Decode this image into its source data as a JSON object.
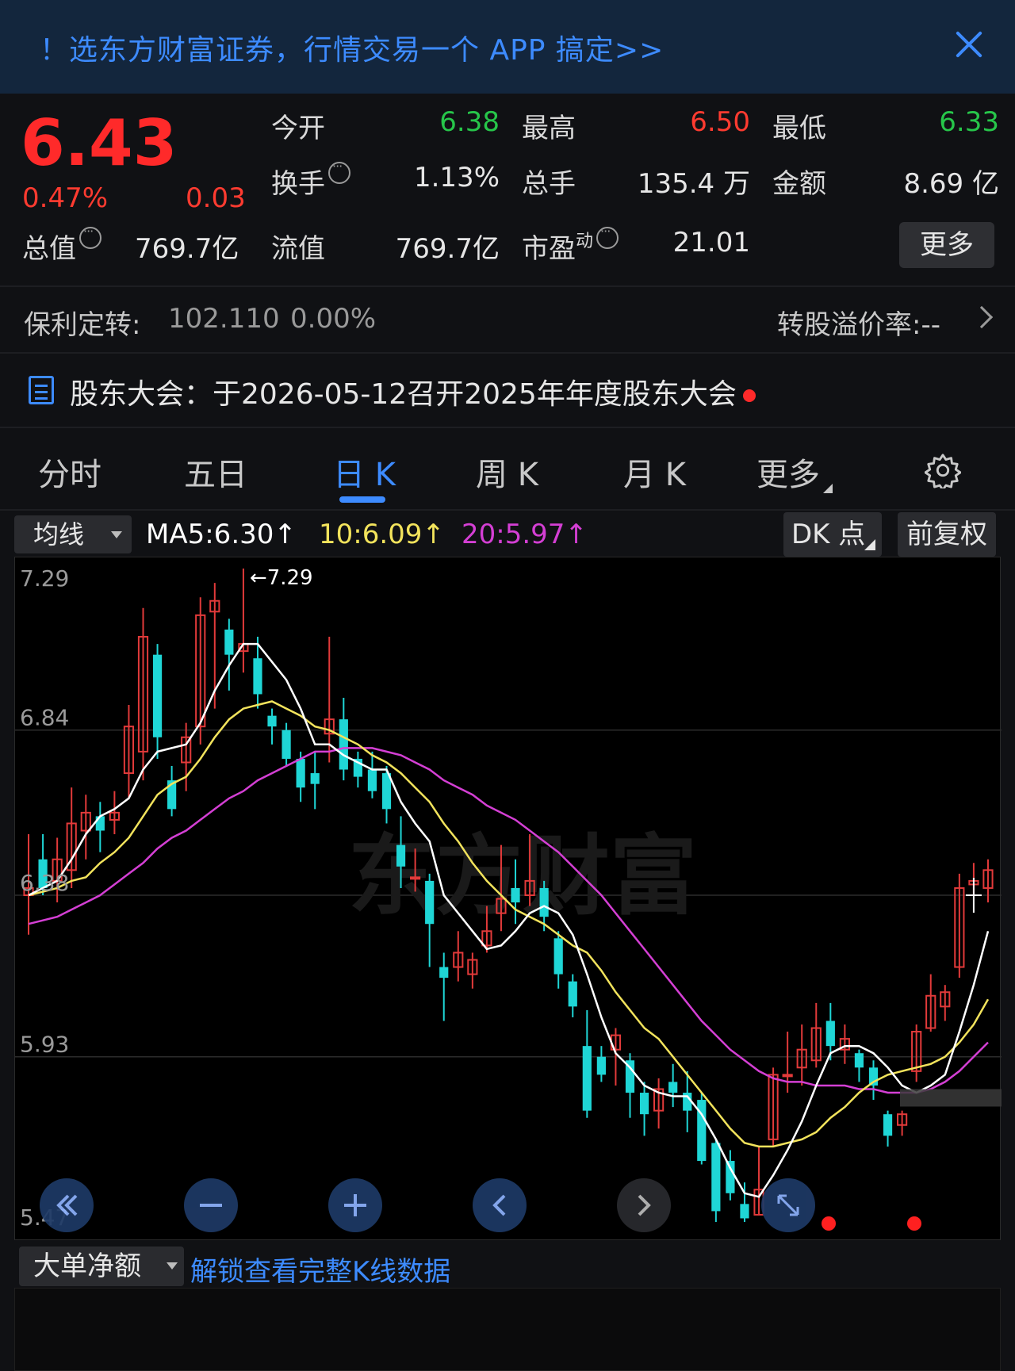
{
  "banner": {
    "text": "！选东方财富证券，行情交易一个 APP 搞定>>"
  },
  "quote": {
    "price": "6.43",
    "change_pct": "0.47%",
    "change_abs": "0.03",
    "total_value_label": "总值",
    "total_value": "769.7亿",
    "open_label": "今开",
    "open": "6.38",
    "high_label": "最高",
    "high": "6.50",
    "low_label": "最低",
    "low": "6.33",
    "turnover_label": "换手",
    "turnover": "1.13%",
    "volume_label": "总手",
    "volume": "135.4 万",
    "amount_label": "金额",
    "amount": "8.69 亿",
    "float_label": "流值",
    "float": "769.7亿",
    "pe_label": "市盈",
    "pe_sup": "动",
    "pe": "21.01",
    "more_label": "更多"
  },
  "convertible": {
    "label": "保利定转:",
    "price": "102.110",
    "pct": "0.00%",
    "premium": "转股溢价率:--"
  },
  "notice": {
    "text": "股东大会：于2026-05-12召开2025年年度股东大会"
  },
  "tabs": [
    {
      "label": "分时"
    },
    {
      "label": "五日"
    },
    {
      "label": "日 K"
    },
    {
      "label": "周 K"
    },
    {
      "label": "月 K"
    },
    {
      "label": "更多"
    }
  ],
  "ma": {
    "selector": "均线",
    "ma5": "MA5:6.30↑",
    "ma10": "10:6.09↑",
    "ma20": "20:5.97↑",
    "dk": "DK 点",
    "fq": "前复权"
  },
  "chart_data": {
    "type": "candlestick",
    "y_ticks": [
      "7.29",
      "6.84",
      "6.38",
      "5.93",
      "5.47"
    ],
    "ylim": [
      5.47,
      7.29
    ],
    "max_label": "←7.29",
    "watermark": "东方财富",
    "candles": [
      [
        6.38,
        6.4,
        6.55,
        6.27
      ],
      [
        6.48,
        6.4,
        6.55,
        6.38
      ],
      [
        6.42,
        6.48,
        6.54,
        6.36
      ],
      [
        6.45,
        6.58,
        6.68,
        6.4
      ],
      [
        6.56,
        6.61,
        6.66,
        6.48
      ],
      [
        6.6,
        6.56,
        6.64,
        6.5
      ],
      [
        6.59,
        6.61,
        6.67,
        6.55
      ],
      [
        6.72,
        6.85,
        6.91,
        6.65
      ],
      [
        6.78,
        7.1,
        7.18,
        6.7
      ],
      [
        7.05,
        6.82,
        7.08,
        6.76
      ],
      [
        6.7,
        6.62,
        6.74,
        6.6
      ],
      [
        6.75,
        6.82,
        6.86,
        6.67
      ],
      [
        6.85,
        7.16,
        7.21,
        6.8
      ],
      [
        7.17,
        7.2,
        7.25,
        6.9
      ],
      [
        7.12,
        7.05,
        7.15,
        6.95
      ],
      [
        7.06,
        7.08,
        7.29,
        7.0
      ],
      [
        7.04,
        6.94,
        7.1,
        6.9
      ],
      [
        6.88,
        6.85,
        6.9,
        6.8
      ],
      [
        6.84,
        6.76,
        6.86,
        6.74
      ],
      [
        6.76,
        6.68,
        6.78,
        6.64
      ],
      [
        6.72,
        6.69,
        6.78,
        6.62
      ],
      [
        6.83,
        6.87,
        7.1,
        6.75
      ],
      [
        6.87,
        6.73,
        6.93,
        6.7
      ],
      [
        6.76,
        6.71,
        6.78,
        6.68
      ],
      [
        6.73,
        6.67,
        6.78,
        6.65
      ],
      [
        6.72,
        6.62,
        6.74,
        6.58
      ],
      [
        6.52,
        6.46,
        6.6,
        6.4
      ],
      [
        6.43,
        6.43,
        6.51,
        6.39
      ],
      [
        6.42,
        6.3,
        6.44,
        6.18
      ],
      [
        6.18,
        6.15,
        6.22,
        6.03
      ],
      [
        6.18,
        6.22,
        6.28,
        6.14
      ],
      [
        6.16,
        6.2,
        6.22,
        6.12
      ],
      [
        6.24,
        6.28,
        6.35,
        6.22
      ],
      [
        6.33,
        6.37,
        6.52,
        6.28
      ],
      [
        6.4,
        6.36,
        6.48,
        6.3
      ],
      [
        6.38,
        6.42,
        6.55,
        6.35
      ],
      [
        6.4,
        6.32,
        6.42,
        6.28
      ],
      [
        6.26,
        6.16,
        6.28,
        6.12
      ],
      [
        6.14,
        6.07,
        6.16,
        6.04
      ],
      [
        5.96,
        5.78,
        6.06,
        5.76
      ],
      [
        5.93,
        5.88,
        5.96,
        5.86
      ],
      [
        5.95,
        5.99,
        6.01,
        5.85
      ],
      [
        5.92,
        5.83,
        5.94,
        5.76
      ],
      [
        5.83,
        5.77,
        5.86,
        5.71
      ],
      [
        5.78,
        5.84,
        5.87,
        5.73
      ],
      [
        5.86,
        5.83,
        5.91,
        5.79
      ],
      [
        5.83,
        5.78,
        5.89,
        5.72
      ],
      [
        5.81,
        5.64,
        5.83,
        5.63
      ],
      [
        5.69,
        5.5,
        5.7,
        5.47
      ],
      [
        5.64,
        5.55,
        5.67,
        5.53
      ],
      [
        5.52,
        5.48,
        5.58,
        5.47
      ],
      [
        5.49,
        5.56,
        5.68,
        5.49
      ],
      [
        5.7,
        5.88,
        5.9,
        5.68
      ],
      [
        5.88,
        5.88,
        6.0,
        5.83
      ],
      [
        5.9,
        5.95,
        6.02,
        5.85
      ],
      [
        5.92,
        6.01,
        6.08,
        5.9
      ],
      [
        6.03,
        5.96,
        6.08,
        5.92
      ],
      [
        5.95,
        5.98,
        6.02,
        5.91
      ],
      [
        5.94,
        5.9,
        5.95,
        5.86
      ],
      [
        5.9,
        5.85,
        5.92,
        5.81
      ],
      [
        5.77,
        5.71,
        5.78,
        5.68
      ],
      [
        5.74,
        5.77,
        5.78,
        5.71
      ],
      [
        5.89,
        6.0,
        6.02,
        5.86
      ],
      [
        6.01,
        6.1,
        6.16,
        6.0
      ],
      [
        6.07,
        6.11,
        6.13,
        6.03
      ],
      [
        6.18,
        6.4,
        6.44,
        6.15
      ],
      [
        6.41,
        6.42,
        6.47,
        6.38
      ],
      [
        6.4,
        6.45,
        6.48,
        6.36
      ]
    ],
    "ma5": [
      6.38,
      6.4,
      6.42,
      6.48,
      6.55,
      6.6,
      6.62,
      6.65,
      6.73,
      6.78,
      6.79,
      6.8,
      6.86,
      6.95,
      7.02,
      7.08,
      7.08,
      7.03,
      6.98,
      6.9,
      6.8,
      6.8,
      6.77,
      6.75,
      6.73,
      6.73,
      6.64,
      6.58,
      6.53,
      6.38,
      6.33,
      6.28,
      6.23,
      6.24,
      6.28,
      6.33,
      6.35,
      6.33,
      6.27,
      6.16,
      6.04,
      5.94,
      5.9,
      5.85,
      5.83,
      5.82,
      5.82,
      5.77,
      5.7,
      5.62,
      5.55,
      5.54,
      5.6,
      5.67,
      5.75,
      5.85,
      5.94,
      5.96,
      5.96,
      5.94,
      5.9,
      5.85,
      5.83,
      5.85,
      5.88,
      6.0,
      6.13,
      6.28
    ],
    "ma10": [
      6.38,
      6.39,
      6.4,
      6.42,
      6.43,
      6.47,
      6.5,
      6.54,
      6.6,
      6.66,
      6.69,
      6.71,
      6.76,
      6.82,
      6.87,
      6.9,
      6.91,
      6.92,
      6.9,
      6.88,
      6.85,
      6.84,
      6.82,
      6.8,
      6.77,
      6.75,
      6.72,
      6.68,
      6.64,
      6.58,
      6.53,
      6.47,
      6.42,
      6.38,
      6.34,
      6.32,
      6.3,
      6.27,
      6.24,
      6.22,
      6.17,
      6.11,
      6.06,
      6.01,
      5.98,
      5.93,
      5.88,
      5.83,
      5.78,
      5.73,
      5.69,
      5.68,
      5.68,
      5.69,
      5.7,
      5.72,
      5.76,
      5.79,
      5.83,
      5.86,
      5.88,
      5.89,
      5.9,
      5.91,
      5.93,
      5.97,
      6.02,
      6.09
    ],
    "ma20": [
      6.3,
      6.31,
      6.32,
      6.34,
      6.36,
      6.38,
      6.41,
      6.44,
      6.47,
      6.51,
      6.54,
      6.56,
      6.59,
      6.62,
      6.65,
      6.67,
      6.7,
      6.72,
      6.74,
      6.76,
      6.78,
      6.78,
      6.79,
      6.79,
      6.79,
      6.78,
      6.77,
      6.75,
      6.73,
      6.7,
      6.68,
      6.66,
      6.63,
      6.61,
      6.59,
      6.56,
      6.53,
      6.5,
      6.46,
      6.42,
      6.38,
      6.33,
      6.28,
      6.23,
      6.18,
      6.13,
      6.08,
      6.03,
      5.99,
      5.95,
      5.92,
      5.89,
      5.87,
      5.86,
      5.86,
      5.85,
      5.85,
      5.85,
      5.84,
      5.84,
      5.83,
      5.83,
      5.83,
      5.84,
      5.86,
      5.89,
      5.93,
      5.97
    ]
  },
  "nav": {
    "first": "first-icon",
    "zoom_out": "minus-icon",
    "zoom_in": "plus-icon",
    "prev": "prev-icon",
    "next": "next-icon",
    "expand": "expand-icon"
  },
  "bottom": {
    "selector": "大单净额",
    "unlock": "解锁查看完整K线数据"
  },
  "colors": {
    "up": "#e23a3a",
    "down": "#1fd6d6",
    "accent": "#3d8bff",
    "ma5": "#ffffff",
    "ma10": "#f2e35c",
    "ma20": "#d43fd4"
  }
}
